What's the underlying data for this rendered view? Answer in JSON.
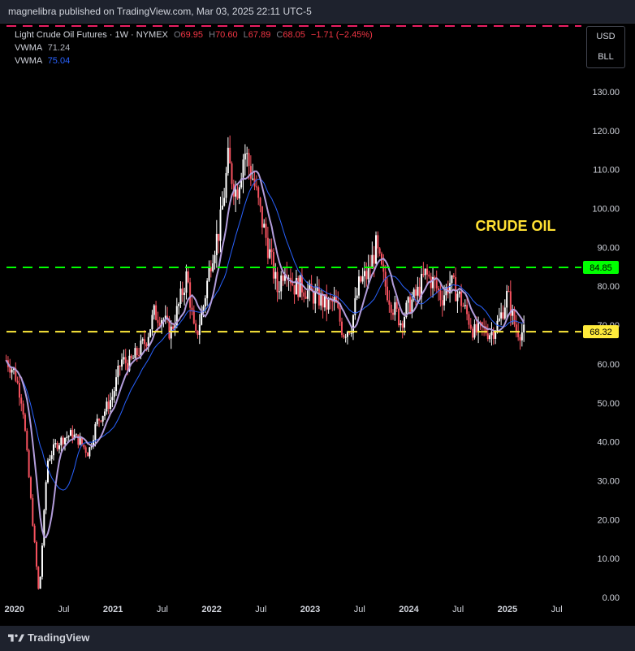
{
  "header": {
    "published": "magnelibra published on TradingView.com, Mar 03, 2025 22:11 UTC-5"
  },
  "legend": {
    "symbol": "Light Crude Oil Futures · 1W · NYMEX",
    "o_label": "O",
    "o_value": "69.95",
    "h_label": "H",
    "h_value": "70.60",
    "l_label": "L",
    "l_value": "67.89",
    "c_label": "C",
    "c_value": "68.05",
    "change": "−1.71 (−2.45%)",
    "vwma1_label": "VWMA",
    "vwma1_value": "71.24",
    "vwma2_label": "VWMA",
    "vwma2_value": "75.04"
  },
  "currency": {
    "usd": "USD",
    "unit": "BLL"
  },
  "footer": {
    "brand": "TradingView"
  },
  "colors": {
    "up": "#ffffff",
    "down": "#f7525f",
    "vwma_fast": "#b39ddb",
    "vwma_slow": "#2962ff",
    "resistance": "#00ff00",
    "support": "#ffeb3b",
    "title": "#ffe033",
    "marker": "#e91e63"
  },
  "chart_data": {
    "type": "candlestick",
    "title": "CRUDE OIL",
    "ylim": [
      0,
      130
    ],
    "y_ticks": [
      "130.00",
      "120.00",
      "110.00",
      "100.00",
      "90.00",
      "80.00",
      "70.00",
      "60.00",
      "50.00",
      "40.00",
      "30.00",
      "20.00",
      "10.00",
      "0.00"
    ],
    "x_ticks": [
      "2020",
      "Jul",
      "2021",
      "Jul",
      "2022",
      "Jul",
      "2023",
      "Jul",
      "2024",
      "Jul",
      "2025",
      "Jul"
    ],
    "horizontal_levels": [
      {
        "value": 84.85,
        "label": "84.85",
        "color": "#00ff00"
      },
      {
        "value": 68.32,
        "label": "68.32",
        "color": "#ffeb3b"
      }
    ],
    "price_path": [
      [
        "2019-12",
        61
      ],
      [
        "2020-01",
        58
      ],
      [
        "2020-02",
        50
      ],
      [
        "2020-03",
        25
      ],
      [
        "2020-04",
        0
      ],
      [
        "2020-05",
        35
      ],
      [
        "2020-06",
        39
      ],
      [
        "2020-07",
        41
      ],
      [
        "2020-08",
        42
      ],
      [
        "2020-09",
        40
      ],
      [
        "2020-10",
        37
      ],
      [
        "2020-11",
        45
      ],
      [
        "2020-12",
        48
      ],
      [
        "2021-01",
        52
      ],
      [
        "2021-02",
        61
      ],
      [
        "2021-03",
        60
      ],
      [
        "2021-04",
        63
      ],
      [
        "2021-05",
        66
      ],
      [
        "2021-06",
        73
      ],
      [
        "2021-07",
        72
      ],
      [
        "2021-08",
        68
      ],
      [
        "2021-09",
        75
      ],
      [
        "2021-10",
        83
      ],
      [
        "2021-11",
        66
      ],
      [
        "2021-12",
        75
      ],
      [
        "2022-01",
        88
      ],
      [
        "2022-02",
        95
      ],
      [
        "2022-03",
        112
      ],
      [
        "2022-04",
        104
      ],
      [
        "2022-05",
        115
      ],
      [
        "2022-06",
        108
      ],
      [
        "2022-07",
        98
      ],
      [
        "2022-08",
        89
      ],
      [
        "2022-09",
        79
      ],
      [
        "2022-10",
        86
      ],
      [
        "2022-11",
        80
      ],
      [
        "2022-12",
        80
      ],
      [
        "2023-01",
        78
      ],
      [
        "2023-02",
        77
      ],
      [
        "2023-03",
        75
      ],
      [
        "2023-04",
        76
      ],
      [
        "2023-05",
        68
      ],
      [
        "2023-06",
        70
      ],
      [
        "2023-07",
        81
      ],
      [
        "2023-08",
        83
      ],
      [
        "2023-09",
        90
      ],
      [
        "2023-10",
        81
      ],
      [
        "2023-11",
        75
      ],
      [
        "2023-12",
        71
      ],
      [
        "2024-01",
        75
      ],
      [
        "2024-02",
        78
      ],
      [
        "2024-03",
        83
      ],
      [
        "2024-04",
        81
      ],
      [
        "2024-05",
        77
      ],
      [
        "2024-06",
        81
      ],
      [
        "2024-07",
        78
      ],
      [
        "2024-08",
        73
      ],
      [
        "2024-09",
        68
      ],
      [
        "2024-10",
        69
      ],
      [
        "2024-11",
        68
      ],
      [
        "2024-12",
        71
      ],
      [
        "2025-01",
        78
      ],
      [
        "2025-02",
        69
      ],
      [
        "2025-03",
        68
      ]
    ],
    "vwma_fast": {
      "name": "VWMA",
      "value": 71.24
    },
    "vwma_slow": {
      "name": "VWMA",
      "value": 75.04
    }
  }
}
